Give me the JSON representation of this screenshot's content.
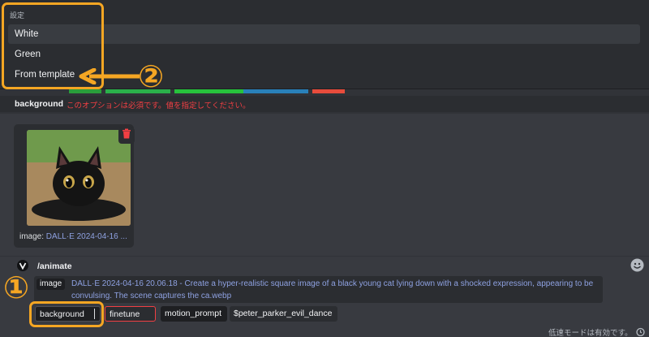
{
  "popup": {
    "title": "設定",
    "options": [
      {
        "label": "White",
        "highlighted": true
      },
      {
        "label": "Green",
        "highlighted": false
      },
      {
        "label": "From template",
        "highlighted": false
      }
    ]
  },
  "error": {
    "option_name": "background",
    "message": "このオプションは必須です。値を指定してください。"
  },
  "attachment": {
    "name_prefix": "image: ",
    "name_link": "DALL·E 2024-04-16 ..."
  },
  "command": {
    "name": "/animate",
    "options": [
      {
        "label": "image",
        "value": "DALL·E 2024-04-16 20.06.18 - Create a hyper-realistic square image of a black young cat lying down with a shocked expression, appearing to be convulsing. The scene captures the ca.webp"
      },
      {
        "label": "background"
      },
      {
        "label": "finetune"
      },
      {
        "label": "motion_prompt",
        "value": "$peter_parker_evil_dance"
      }
    ]
  },
  "status": {
    "slowmode": "低速モードは有効です。"
  },
  "annotations": {
    "marker_1": "①",
    "marker_2": "②",
    "color": "#f5a623"
  },
  "icons": {
    "trash": "trash-icon",
    "bot_avatar": "bot-avatar-icon",
    "emoji": "emoji-icon",
    "slowmode": "timer-icon"
  },
  "colors": {
    "background": "#313338",
    "popup": "#2b2d31",
    "link": "#8ea1e1",
    "error": "#f23f43"
  }
}
